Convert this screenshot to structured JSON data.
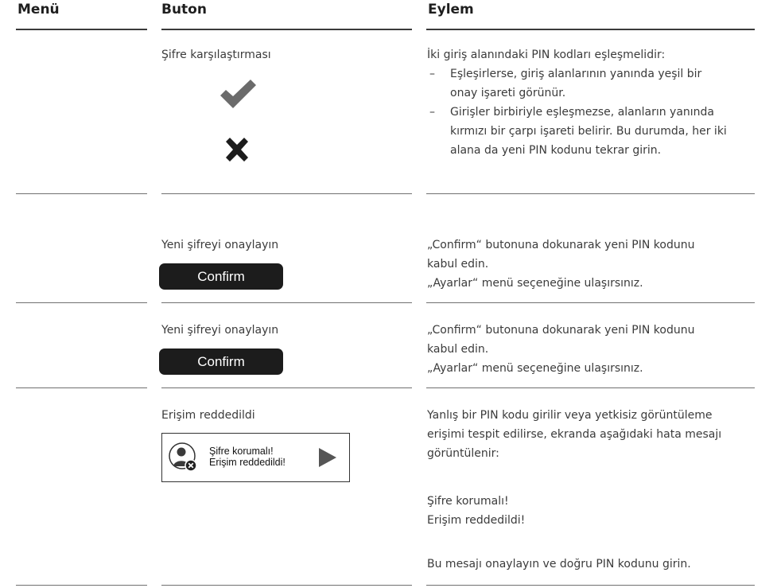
{
  "columns": {
    "menu": "Menü",
    "button": "Buton",
    "action": "Eylem"
  },
  "rows": [
    {
      "button_title": "Şifre karşılaştırması",
      "icons": [
        "checkmark-icon",
        "cross-icon"
      ],
      "intro": "İki giriş alanındaki PIN kodları eşleşmelidir:",
      "bullets": [
        [
          "Eşleşirlerse, giriş alanlarının yanında yeşil bir",
          "onay işareti görünür."
        ],
        [
          "Girişler birbiriyle eşleşmezse, alanların yanında",
          "kırmızı bir çarpı işareti belirir. Bu durumda, her iki",
          "alana da yeni PIN kodunu tekrar girin."
        ]
      ]
    },
    {
      "button_title": "Yeni şifreyi onaylayın",
      "button_label": "Confirm",
      "action_lines": [
        "„Confirm“ butonuna dokunarak yeni PIN kodunu",
        "kabul edin.",
        "„Ayarlar“ menü seçeneğine ulaşırsınız."
      ]
    },
    {
      "button_title": "Yeni şifreyi onaylayın",
      "button_label": "Confirm",
      "action_lines": [
        "„Confirm“ butonuna dokunarak yeni PIN kodunu",
        "kabul edin.",
        "„Ayarlar“ menü seçeneğine ulaşırsınız."
      ]
    },
    {
      "button_title": "Erişim reddedildi",
      "dialog_line1": "Şifre korumalı!",
      "dialog_line2": "Erişim reddedildi!",
      "action_lines": [
        "Yanlış bir PIN kodu girilir veya yetkisiz görüntüleme",
        "erişimi tespit edilirse, ekranda aşağıdaki hata mesajı",
        "görüntülenir:"
      ],
      "message_lines": [
        "Şifre korumalı!",
        "Erişim reddedildi!"
      ],
      "final_line": "Bu mesajı onaylayın ve doğru PIN kodunu girin."
    }
  ],
  "bullet_dash": "–"
}
